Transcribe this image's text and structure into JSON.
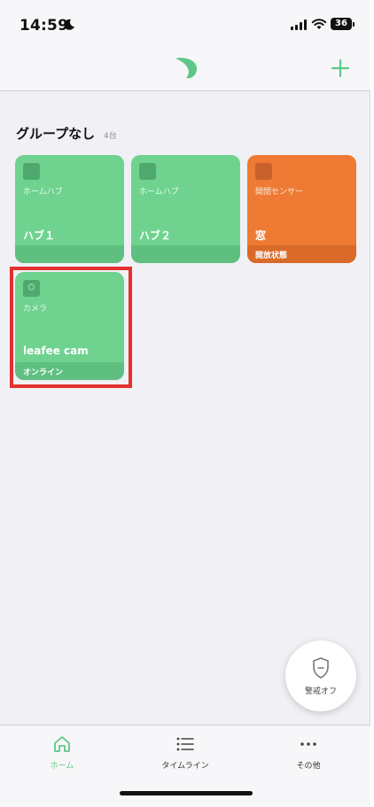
{
  "status_bar": {
    "time": "14:59",
    "battery": "36"
  },
  "colors": {
    "accent": "#5dc787",
    "card_green": "#6fd38f",
    "card_orange": "#ee7a33",
    "highlight": "#e2322d"
  },
  "header": {
    "logo_icon": "leaf-icon",
    "add_icon": "plus-icon"
  },
  "group": {
    "title": "グループなし",
    "count": "4台"
  },
  "devices": [
    {
      "type": "ホームハブ",
      "name": "ハブ１",
      "status": "",
      "icon": "hub-icon"
    },
    {
      "type": "ホームハブ",
      "name": "ハブ２",
      "status": "",
      "icon": "hub-icon"
    },
    {
      "type": "開閉センサー",
      "name": "窓",
      "status": "開放状態",
      "icon": "door-sensor-icon"
    },
    {
      "type": "カメラ",
      "name": "leafee cam",
      "status": "オンライン",
      "icon": "camera-icon"
    }
  ],
  "alarm": {
    "label": "警戒オフ",
    "icon": "shield-icon"
  },
  "tabs": [
    {
      "label": "ホーム",
      "icon": "home-icon",
      "active": true
    },
    {
      "label": "タイムライン",
      "icon": "list-icon",
      "active": false
    },
    {
      "label": "その他",
      "icon": "more-icon",
      "active": false
    }
  ]
}
